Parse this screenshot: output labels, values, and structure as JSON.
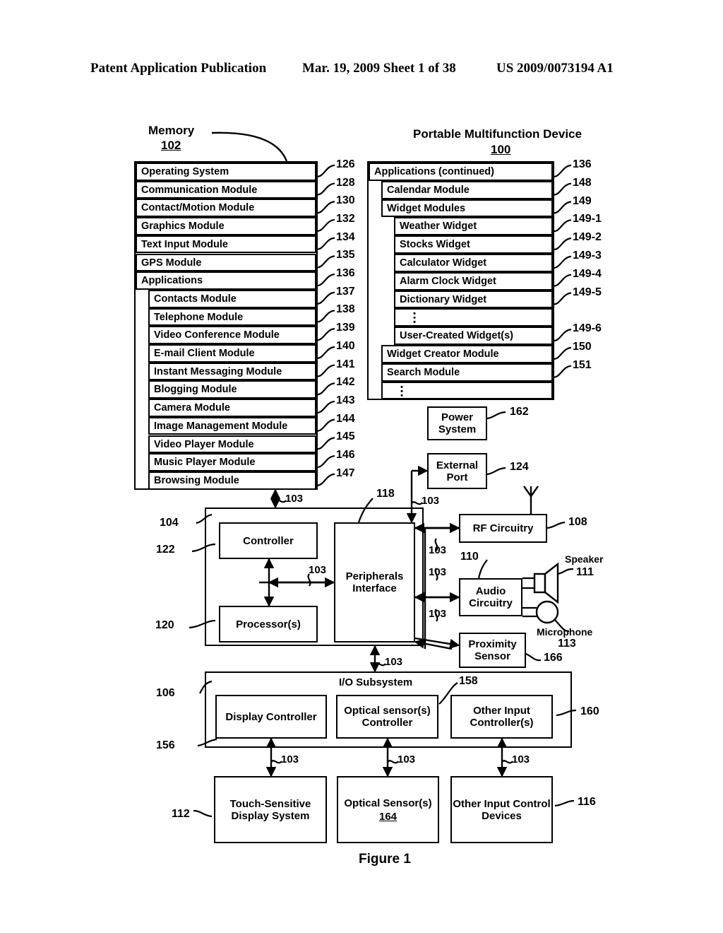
{
  "header": {
    "publication": "Patent Application Publication",
    "date_sheet": "Mar. 19, 2009  Sheet 1 of 38",
    "patent_number": "US 2009/0073194 A1"
  },
  "figure": {
    "caption": "Figure 1",
    "memory_title": "Memory",
    "memory_ref": "102",
    "device_title": "Portable Multifunction Device",
    "device_ref": "100"
  },
  "memory_items": [
    {
      "label": "Operating System",
      "ref": "126",
      "indent": 0
    },
    {
      "label": "Communication Module",
      "ref": "128",
      "indent": 0
    },
    {
      "label": "Contact/Motion Module",
      "ref": "130",
      "indent": 0
    },
    {
      "label": "Graphics Module",
      "ref": "132",
      "indent": 0
    },
    {
      "label": "Text Input Module",
      "ref": "134",
      "indent": 0
    },
    {
      "label": "GPS Module",
      "ref": "135",
      "indent": 0
    },
    {
      "label": "Applications",
      "ref": "136",
      "indent": 0
    },
    {
      "label": "Contacts Module",
      "ref": "137",
      "indent": 1
    },
    {
      "label": "Telephone Module",
      "ref": "138",
      "indent": 1
    },
    {
      "label": "Video Conference Module",
      "ref": "139",
      "indent": 1
    },
    {
      "label": "E-mail Client Module",
      "ref": "140",
      "indent": 1
    },
    {
      "label": "Instant Messaging Module",
      "ref": "141",
      "indent": 1
    },
    {
      "label": "Blogging Module",
      "ref": "142",
      "indent": 1
    },
    {
      "label": "Camera Module",
      "ref": "143",
      "indent": 1
    },
    {
      "label": "Image Management Module",
      "ref": "144",
      "indent": 1
    },
    {
      "label": "Video Player Module",
      "ref": "145",
      "indent": 1
    },
    {
      "label": "Music Player Module",
      "ref": "146",
      "indent": 1
    },
    {
      "label": "Browsing Module",
      "ref": "147",
      "indent": 1
    }
  ],
  "applications_continued": [
    {
      "label": "Applications (continued)",
      "ref": "136",
      "indent": 0
    },
    {
      "label": "Calendar Module",
      "ref": "148",
      "indent": 1
    },
    {
      "label": "Widget Modules",
      "ref": "149",
      "indent": 1
    },
    {
      "label": "Weather Widget",
      "ref": "149-1",
      "indent": 2
    },
    {
      "label": "Stocks Widget",
      "ref": "149-2",
      "indent": 2
    },
    {
      "label": "Calculator Widget",
      "ref": "149-3",
      "indent": 2
    },
    {
      "label": "Alarm Clock Widget",
      "ref": "149-4",
      "indent": 2
    },
    {
      "label": "Dictionary Widget",
      "ref": "149-5",
      "indent": 2
    },
    {
      "label": "",
      "ref": "",
      "indent": 2,
      "ellipsis": true
    },
    {
      "label": "User-Created Widget(s)",
      "ref": "149-6",
      "indent": 2
    },
    {
      "label": "Widget Creator Module",
      "ref": "150",
      "indent": 1
    },
    {
      "label": "Search Module",
      "ref": "151",
      "indent": 1
    },
    {
      "label": "",
      "ref": "",
      "indent": 1,
      "ellipsis": true
    }
  ],
  "blocks": {
    "power_system": {
      "label": "Power System",
      "ref": "162"
    },
    "external_port": {
      "label": "External Port",
      "ref": "124"
    },
    "rf_circuitry": {
      "label": "RF Circuitry",
      "ref": "108"
    },
    "audio_circuitry": {
      "label": "Audio Circuitry",
      "ref": "110"
    },
    "proximity_sensor": {
      "label": "Proximity Sensor",
      "ref": "166"
    },
    "controller": {
      "label": "Controller",
      "ref": "122"
    },
    "processors": {
      "label": "Processor(s)",
      "ref": "120"
    },
    "peripherals": {
      "label": "Peripherals Interface",
      "ref": "118"
    },
    "cpu_group_ref": {
      "label": "",
      "ref": "104"
    },
    "io_subsystem": {
      "label": "I/O Subsystem",
      "ref": "106"
    },
    "display_controller": {
      "label": "Display Controller",
      "ref": "156"
    },
    "optical_controller": {
      "label": "Optical sensor(s) Controller",
      "ref": "158"
    },
    "other_input_ctrl": {
      "label": "Other Input Controller(s)",
      "ref": "160"
    },
    "touch_display": {
      "label": "Touch-Sensitive Display System",
      "ref": "112"
    },
    "optical_sensors": {
      "label": "Optical Sensor(s)",
      "sub_ref": "164",
      "ref": ""
    },
    "other_input_dev": {
      "label": "Other Input Control Devices",
      "ref": "116"
    },
    "speaker": {
      "label": "Speaker",
      "ref": "111"
    },
    "microphone": {
      "label": "Microphone",
      "ref": "113"
    }
  },
  "bus_label": "103",
  "colors": {
    "ink": "#000000",
    "paper": "#ffffff"
  }
}
